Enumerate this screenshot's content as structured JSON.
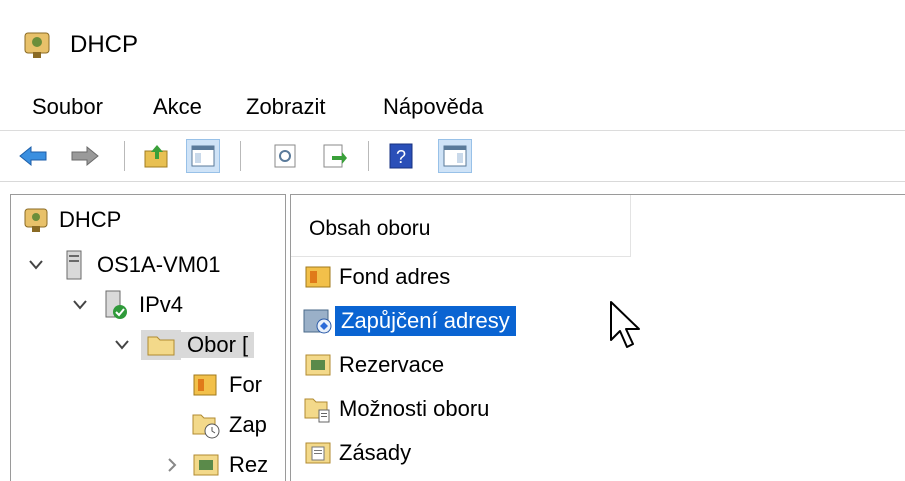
{
  "window": {
    "title": "DHCP"
  },
  "menu": [
    "Soubor",
    "Akce",
    "Zobrazit",
    "Nápověda"
  ],
  "toolbar": {
    "buttons": [
      "back-arrow-icon",
      "forward-arrow-icon",
      "up-folder-icon",
      "show-console-tree-icon",
      "refresh-icon",
      "export-list-icon",
      "help-icon",
      "action-pane-icon"
    ]
  },
  "tree": {
    "root": "DHCP",
    "server": "OS1A-VM01",
    "ipv4": "IPv4",
    "scope": "Obor [",
    "children": [
      "For",
      "Zap",
      "Rez"
    ]
  },
  "content": {
    "header": "Obsah oboru",
    "items": [
      {
        "label": "Fond adres",
        "icon": "address-pool-icon"
      },
      {
        "label": "Zapůjčení adresy",
        "icon": "address-leases-icon",
        "selected": true
      },
      {
        "label": "Rezervace",
        "icon": "reservations-icon"
      },
      {
        "label": "Možnosti oboru",
        "icon": "scope-options-icon"
      },
      {
        "label": "Zásady",
        "icon": "policies-icon"
      }
    ]
  },
  "colors": {
    "selection": "#0a64d2",
    "tree_selection": "#d9d9d9"
  }
}
